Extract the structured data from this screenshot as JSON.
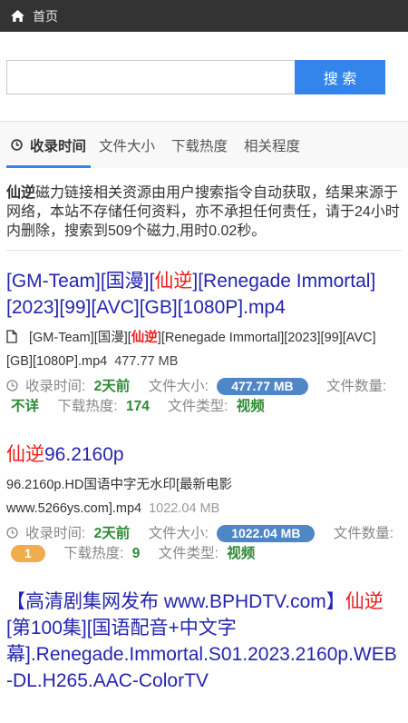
{
  "colors": {
    "topbar": "#333333",
    "accent": "#3385eb",
    "link": "#2424b0",
    "keyword": "#ee1c1c",
    "value_green": "#2d8a34",
    "size_badge": "#4f86c6",
    "count_badge": "#f0ad4e"
  },
  "topbar": {
    "icon": "home-icon",
    "title": "首页"
  },
  "search": {
    "button_label": "搜 索"
  },
  "sort_tabs": [
    {
      "label": "收录时间",
      "active": true,
      "icon": "clock-icon"
    },
    {
      "label": "文件大小",
      "active": false
    },
    {
      "label": "下载热度",
      "active": false
    },
    {
      "label": "相关程度",
      "active": false
    }
  ],
  "notice": {
    "keyword": "仙逆",
    "text": "磁力链接相关资源由用户搜索指令自动获取，结果来源于网络，本站不存储任何资料，亦不承担任何责任，请于24小时内删除，搜索到509个磁力,用时0.02秒。"
  },
  "labels": {
    "added": "收录时间:",
    "size": "文件大小:",
    "count": "文件数量:",
    "heat": "下载热度:",
    "type": "文件类型:"
  },
  "results": [
    {
      "title": {
        "pre": "[GM-Team][国漫][",
        "keyword": "仙逆",
        "post": "][Renegade Immortal][2023][99][AVC][GB][1080P].mp4"
      },
      "file": {
        "icon": "file-icon",
        "pre": "[GM-Team][国漫][",
        "keyword": "仙逆",
        "post": "][Renegade Immortal][2023][99][AVC][GB][1080P].mp4"
      },
      "added": "2天前",
      "size": "477.77 MB",
      "count": "不详",
      "heat": "174",
      "type": "视频"
    },
    {
      "title": {
        "keyword": "仙逆",
        "post": "96.2160p"
      },
      "file": {
        "name": "96.2160p.HD国语中字无水印[最新电影www.5266ys.com].mp4"
      },
      "added": "2天前",
      "size": "1022.04 MB",
      "count": "1",
      "heat": "9",
      "type": "视频"
    },
    {
      "title": {
        "pre": "【高清剧集网发布 www.BPHDTV.com】",
        "keyword": "仙逆",
        "post": "[第100集][国语配音+中文字幕].Renegade.Immortal.S01.2023.2160p.WEB-DL.H265.AAC-ColorTV"
      }
    }
  ]
}
